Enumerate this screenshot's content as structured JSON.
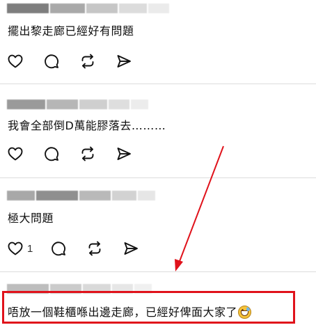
{
  "comments": [
    {
      "text": "擺出黎走廊已經好有問題",
      "like_count": "",
      "name_blur_colors": [
        "#7e7e7e",
        "#a6a6a6",
        "#c4c4c4",
        "#d8d8d8",
        "#e9e9e9"
      ]
    },
    {
      "text": "我會全部倒D萬能膠落去………",
      "like_count": "",
      "name_blur_colors": [
        "#9a9a9a",
        "#b6b6b6",
        "#cfcfcf",
        "#dddddd",
        "#ececec"
      ]
    },
    {
      "text": "極大問題",
      "like_count": "",
      "name_blur_colors": [
        "#a0a0a0",
        "#8f8f8f",
        "#b9b9b9",
        "#d2d2d2",
        "#e6e6e6"
      ]
    },
    {
      "text": "",
      "like_count": "1",
      "name_blur_colors": []
    },
    {
      "text": "唔放一個鞋櫃喺出邊走廊，已經好俾面大家了",
      "emoji": "grinning-face-with-sweat",
      "like_count": "",
      "name_blur_colors": [
        "#b5b5b5",
        "#cbcbcb",
        "#d9d9d9",
        "#e6e6e6",
        "#f0f0f0"
      ]
    }
  ],
  "icons": {
    "like": "heart-icon",
    "reply": "comment-bubble-icon",
    "repost": "repost-icon",
    "share": "send-icon"
  },
  "annotation": {
    "box_color": "#e0121b",
    "arrow_color": "#e0121b"
  }
}
